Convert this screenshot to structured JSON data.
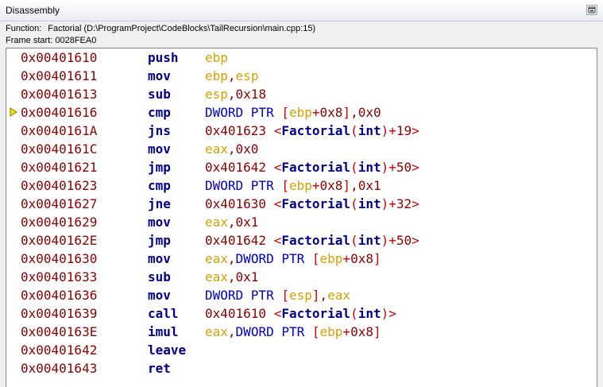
{
  "window": {
    "title": "Disassembly"
  },
  "info": {
    "function_label": "Function:",
    "function_value": "Factorial (D:\\ProgramProject\\CodeBlocks\\TailRecursion\\main.cpp:15)",
    "frame_start": "Frame start: 0028FEA0"
  },
  "current_row_index": 3,
  "colors": {
    "address": "#8b0000",
    "mnemonic": "#00008b",
    "register": "#d4a000",
    "keyword": "#0000cc",
    "number": "#8b0000",
    "punctuation": "#cc0000",
    "function": "#00008b",
    "current_arrow": "#f2e400"
  },
  "rows": [
    {
      "addr": "0x00401610",
      "mnem": "push",
      "ops": [
        [
          "reg",
          "ebp"
        ]
      ]
    },
    {
      "addr": "0x00401611",
      "mnem": "mov",
      "ops": [
        [
          "reg",
          "ebp"
        ],
        [
          "num",
          ","
        ],
        [
          "reg",
          "esp"
        ]
      ]
    },
    {
      "addr": "0x00401613",
      "mnem": "sub",
      "ops": [
        [
          "reg",
          "esp"
        ],
        [
          "num",
          ",0x18"
        ]
      ]
    },
    {
      "addr": "0x00401616",
      "mnem": "cmp",
      "ops": [
        [
          "kw",
          "DWORD PTR "
        ],
        [
          "pun",
          "["
        ],
        [
          "reg",
          "ebp"
        ],
        [
          "pun",
          "+"
        ],
        [
          "num",
          "0x8"
        ],
        [
          "pun",
          "]"
        ],
        [
          "num",
          ",0x0"
        ]
      ]
    },
    {
      "addr": "0x0040161A",
      "mnem": "jns",
      "ops": [
        [
          "num",
          "0x401623 "
        ],
        [
          "pun",
          "<"
        ],
        [
          "fn",
          "Factorial"
        ],
        [
          "pun",
          "("
        ],
        [
          "fn",
          "int"
        ],
        [
          "pun",
          ")+"
        ],
        [
          "num",
          "19"
        ],
        [
          "pun",
          ">"
        ]
      ]
    },
    {
      "addr": "0x0040161C",
      "mnem": "mov",
      "ops": [
        [
          "reg",
          "eax"
        ],
        [
          "num",
          ",0x0"
        ]
      ]
    },
    {
      "addr": "0x00401621",
      "mnem": "jmp",
      "ops": [
        [
          "num",
          "0x401642 "
        ],
        [
          "pun",
          "<"
        ],
        [
          "fn",
          "Factorial"
        ],
        [
          "pun",
          "("
        ],
        [
          "fn",
          "int"
        ],
        [
          "pun",
          ")+"
        ],
        [
          "num",
          "50"
        ],
        [
          "pun",
          ">"
        ]
      ]
    },
    {
      "addr": "0x00401623",
      "mnem": "cmp",
      "ops": [
        [
          "kw",
          "DWORD PTR "
        ],
        [
          "pun",
          "["
        ],
        [
          "reg",
          "ebp"
        ],
        [
          "pun",
          "+"
        ],
        [
          "num",
          "0x8"
        ],
        [
          "pun",
          "]"
        ],
        [
          "num",
          ",0x1"
        ]
      ]
    },
    {
      "addr": "0x00401627",
      "mnem": "jne",
      "ops": [
        [
          "num",
          "0x401630 "
        ],
        [
          "pun",
          "<"
        ],
        [
          "fn",
          "Factorial"
        ],
        [
          "pun",
          "("
        ],
        [
          "fn",
          "int"
        ],
        [
          "pun",
          ")+"
        ],
        [
          "num",
          "32"
        ],
        [
          "pun",
          ">"
        ]
      ]
    },
    {
      "addr": "0x00401629",
      "mnem": "mov",
      "ops": [
        [
          "reg",
          "eax"
        ],
        [
          "num",
          ",0x1"
        ]
      ]
    },
    {
      "addr": "0x0040162E",
      "mnem": "jmp",
      "ops": [
        [
          "num",
          "0x401642 "
        ],
        [
          "pun",
          "<"
        ],
        [
          "fn",
          "Factorial"
        ],
        [
          "pun",
          "("
        ],
        [
          "fn",
          "int"
        ],
        [
          "pun",
          ")+"
        ],
        [
          "num",
          "50"
        ],
        [
          "pun",
          ">"
        ]
      ]
    },
    {
      "addr": "0x00401630",
      "mnem": "mov",
      "ops": [
        [
          "reg",
          "eax"
        ],
        [
          "num",
          ","
        ],
        [
          "kw",
          "DWORD PTR "
        ],
        [
          "pun",
          "["
        ],
        [
          "reg",
          "ebp"
        ],
        [
          "pun",
          "+"
        ],
        [
          "num",
          "0x8"
        ],
        [
          "pun",
          "]"
        ]
      ]
    },
    {
      "addr": "0x00401633",
      "mnem": "sub",
      "ops": [
        [
          "reg",
          "eax"
        ],
        [
          "num",
          ",0x1"
        ]
      ]
    },
    {
      "addr": "0x00401636",
      "mnem": "mov",
      "ops": [
        [
          "kw",
          "DWORD PTR "
        ],
        [
          "pun",
          "["
        ],
        [
          "reg",
          "esp"
        ],
        [
          "pun",
          "]"
        ],
        [
          "num",
          ","
        ],
        [
          "reg",
          "eax"
        ]
      ]
    },
    {
      "addr": "0x00401639",
      "mnem": "call",
      "ops": [
        [
          "num",
          "0x401610 "
        ],
        [
          "pun",
          "<"
        ],
        [
          "fn",
          "Factorial"
        ],
        [
          "pun",
          "("
        ],
        [
          "fn",
          "int"
        ],
        [
          "pun",
          ")>"
        ]
      ]
    },
    {
      "addr": "0x0040163E",
      "mnem": "imul",
      "ops": [
        [
          "reg",
          "eax"
        ],
        [
          "num",
          ","
        ],
        [
          "kw",
          "DWORD PTR "
        ],
        [
          "pun",
          "["
        ],
        [
          "reg",
          "ebp"
        ],
        [
          "pun",
          "+"
        ],
        [
          "num",
          "0x8"
        ],
        [
          "pun",
          "]"
        ]
      ]
    },
    {
      "addr": "0x00401642",
      "mnem": "leave",
      "ops": []
    },
    {
      "addr": "0x00401643",
      "mnem": "ret",
      "ops": []
    }
  ]
}
